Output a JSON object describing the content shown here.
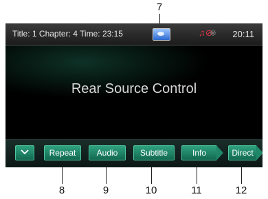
{
  "callouts": {
    "top": "7",
    "bottom": [
      "8",
      "9",
      "10",
      "11",
      "12"
    ]
  },
  "status": {
    "playback_info": "Title: 1 Chapter: 4 Time: 23:15",
    "clock": "20:11",
    "icons": [
      "source-icon",
      "mute-icon",
      "bluetooth-icon"
    ]
  },
  "screen": {
    "title": "Rear Source Control"
  },
  "controls": {
    "chevron_icon": "chevron-down-icon",
    "repeat": "Repeat",
    "audio": "Audio",
    "subtitle": "Subtitle",
    "info": "Info",
    "direct": "Direct"
  },
  "colors": {
    "button": "#1f8667",
    "button_border": "#4fc79f",
    "screen_bg": "#000000"
  }
}
